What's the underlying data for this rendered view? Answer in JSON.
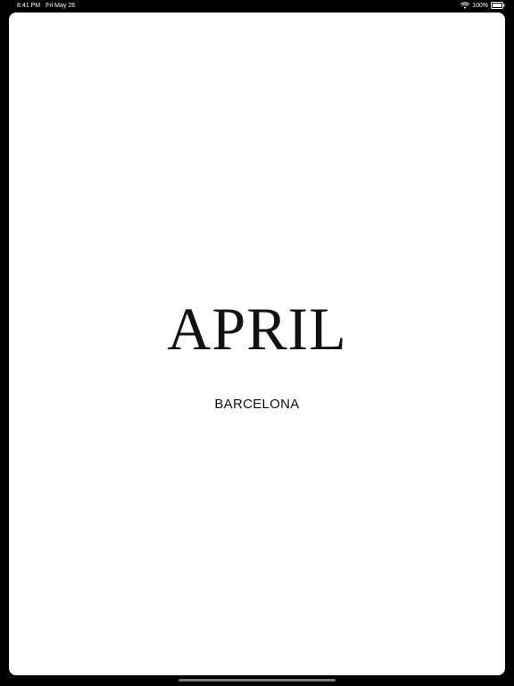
{
  "status_bar": {
    "time": "8:41 PM",
    "date": "Fri May 26",
    "battery": "100%",
    "wifi_icon": "wifi-icon",
    "battery_icon": "battery-icon"
  },
  "splash": {
    "title": "APRIL",
    "subtitle": "BARCELONA"
  },
  "colors": {
    "background": "#000000",
    "screen": "#ffffff",
    "text": "#111111"
  }
}
